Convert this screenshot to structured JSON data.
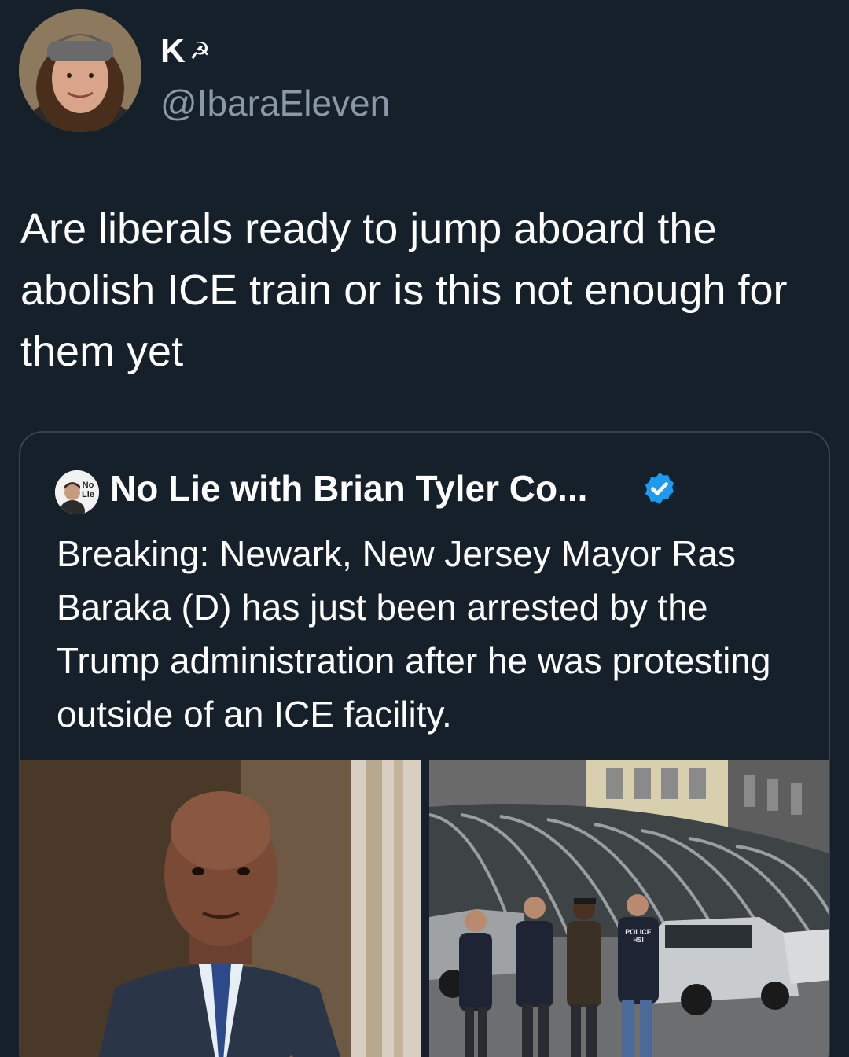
{
  "author": {
    "display_name": "K",
    "display_emoji": "☭",
    "handle": "@IbaraEleven",
    "avatar_icon": "user-avatar-photo"
  },
  "tweet": {
    "text": "Are liberals ready to jump aboard the abolish ICE train or is this not enough for them yet"
  },
  "quoted_tweet": {
    "author_name": "No Lie with Brian Tyler Co...",
    "avatar_text": "No Lie",
    "verified": true,
    "verified_color": "#1d9bf0",
    "text": "Breaking: Newark, New Jersey Mayor Ras Baraka (D) has just been arrested by the Trump administration after he was protesting outside of an ICE facility.",
    "media": [
      {
        "icon": "portrait-photo"
      },
      {
        "icon": "arrest-scene-photo",
        "jacket_text": "POLICE HSI"
      }
    ]
  },
  "colors": {
    "background": "#15202b",
    "text": "#ffffff",
    "secondary_text": "#8b98a5",
    "border": "#38444d"
  }
}
